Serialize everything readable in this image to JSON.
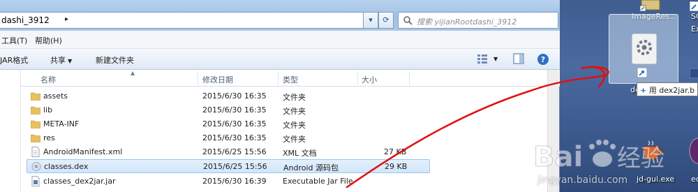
{
  "window": {
    "address": "dashi_3912",
    "search_placeholder": "搜索 yijianRootdashi_3912"
  },
  "menu": [
    "工具(T)",
    "帮助(H)"
  ],
  "toolbar": {
    "jar_format": "JAR格式",
    "share": "共享",
    "new_folder": "新建文件夹"
  },
  "columns": {
    "name": "名称",
    "modified": "修改日期",
    "type": "类型",
    "size": "大小"
  },
  "files": [
    {
      "name": "assets",
      "date": "2015/6/30 16:35",
      "type": "文件夹",
      "size": "",
      "icon": "folder-icon"
    },
    {
      "name": "lib",
      "date": "2015/6/30 16:35",
      "type": "文件夹",
      "size": "",
      "icon": "folder-icon"
    },
    {
      "name": "META-INF",
      "date": "2015/6/30 16:35",
      "type": "文件夹",
      "size": "",
      "icon": "folder-icon"
    },
    {
      "name": "res",
      "date": "2015/6/30 16:35",
      "type": "文件夹",
      "size": "",
      "icon": "folder-icon"
    },
    {
      "name": "AndroidManifest.xml",
      "date": "2015/6/25 15:56",
      "type": "XML 文档",
      "size": "27 KB",
      "icon": "document-icon"
    },
    {
      "name": "classes.dex",
      "date": "2015/6/25 15:56",
      "type": "Android 源码包",
      "size": "29 KB",
      "icon": "dex-file-icon",
      "selected": true
    },
    {
      "name": "classes_dex2jar.jar",
      "date": "2015/6/30 16:39",
      "type": "Executable Jar File",
      "size": "",
      "icon": "jar-file-icon"
    }
  ],
  "desktop": {
    "icon1_label": "ImageRes...",
    "icon2_label_a": "SC",
    "icon2_label_b": "Ex",
    "drag_label_prefix": "de",
    "drag_tooltip": "用 dex2jar.b",
    "jdgui_label": "jd-gui.exe",
    "last_label": "ec"
  },
  "watermark": {
    "brand": "Bai",
    "brand2": "经验",
    "url": "jingyan.baidu.com"
  },
  "colors": {
    "selection": "#d2e6fb",
    "annotation_line": "#e01010",
    "folder": "#e8c060"
  }
}
